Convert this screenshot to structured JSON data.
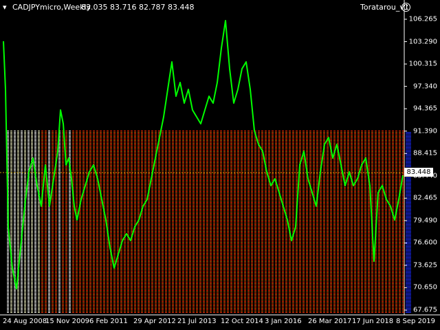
{
  "chart": {
    "symbol_label": "CADJPYmicro,Weekly",
    "ohlc_label": "83.035 83.716 82.787 83.448",
    "indicator_name": "Toratarou_v1",
    "current_price": "83.448",
    "price_scale": [
      "106.265",
      "103.290",
      "100.315",
      "97.340",
      "94.365",
      "91.390",
      "88.415",
      "85.440",
      "82.465",
      "79.490",
      "76.600",
      "73.625",
      "70.650",
      "67.675"
    ],
    "time_scale": [
      "24 Aug 2008",
      "15 Nov 2009",
      "6 Feb 2011",
      "29 Apr 2012",
      "21 Jul 2013",
      "12 Oct 2014",
      "3 Jan 2016",
      "26 Mar 2017",
      "17 Jun 2018",
      "8 Sep 2019"
    ]
  },
  "colors": {
    "background": "#000000",
    "price_line": "#00ff00",
    "bar_red": "#ff2a00",
    "bar_orange": "#d35a00",
    "bar_white": "#ffffff",
    "bar_blue": "#1a2aff",
    "axis": "#ffffff",
    "current_price_line": "#c8a000"
  },
  "icons": {
    "indicator_status": "smiley-icon"
  }
}
